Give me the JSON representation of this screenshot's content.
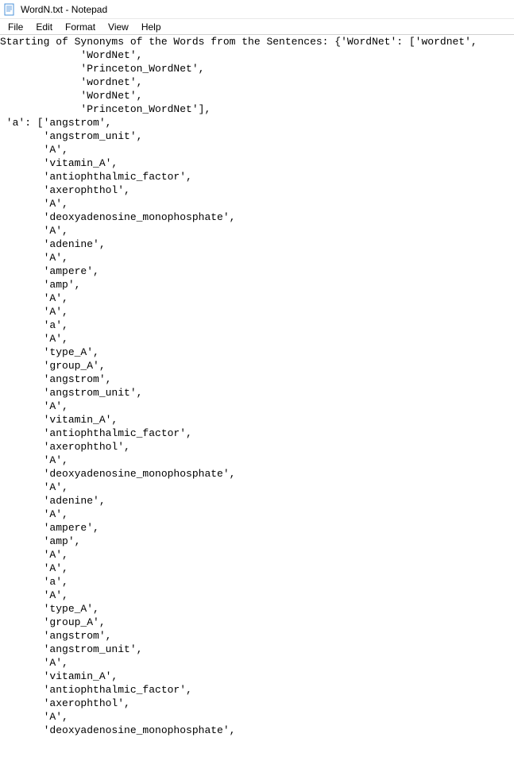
{
  "title_bar": {
    "title": "WordN.txt - Notepad"
  },
  "menu_bar": {
    "items": [
      {
        "label": "File"
      },
      {
        "label": "Edit"
      },
      {
        "label": "Format"
      },
      {
        "label": "View"
      },
      {
        "label": "Help"
      }
    ]
  },
  "content": {
    "lines": [
      "Starting of Synonyms of the Words from the Sentences: {'WordNet': ['wordnet',",
      "             'WordNet',",
      "             'Princeton_WordNet',",
      "             'wordnet',",
      "             'WordNet',",
      "             'Princeton_WordNet'],",
      " 'a': ['angstrom',",
      "       'angstrom_unit',",
      "       'A',",
      "       'vitamin_A',",
      "       'antiophthalmic_factor',",
      "       'axerophthol',",
      "       'A',",
      "       'deoxyadenosine_monophosphate',",
      "       'A',",
      "       'adenine',",
      "       'A',",
      "       'ampere',",
      "       'amp',",
      "       'A',",
      "       'A',",
      "       'a',",
      "       'A',",
      "       'type_A',",
      "       'group_A',",
      "       'angstrom',",
      "       'angstrom_unit',",
      "       'A',",
      "       'vitamin_A',",
      "       'antiophthalmic_factor',",
      "       'axerophthol',",
      "       'A',",
      "       'deoxyadenosine_monophosphate',",
      "       'A',",
      "       'adenine',",
      "       'A',",
      "       'ampere',",
      "       'amp',",
      "       'A',",
      "       'A',",
      "       'a',",
      "       'A',",
      "       'type_A',",
      "       'group_A',",
      "       'angstrom',",
      "       'angstrom_unit',",
      "       'A',",
      "       'vitamin_A',",
      "       'antiophthalmic_factor',",
      "       'axerophthol',",
      "       'A',",
      "       'deoxyadenosine_monophosphate',"
    ]
  }
}
